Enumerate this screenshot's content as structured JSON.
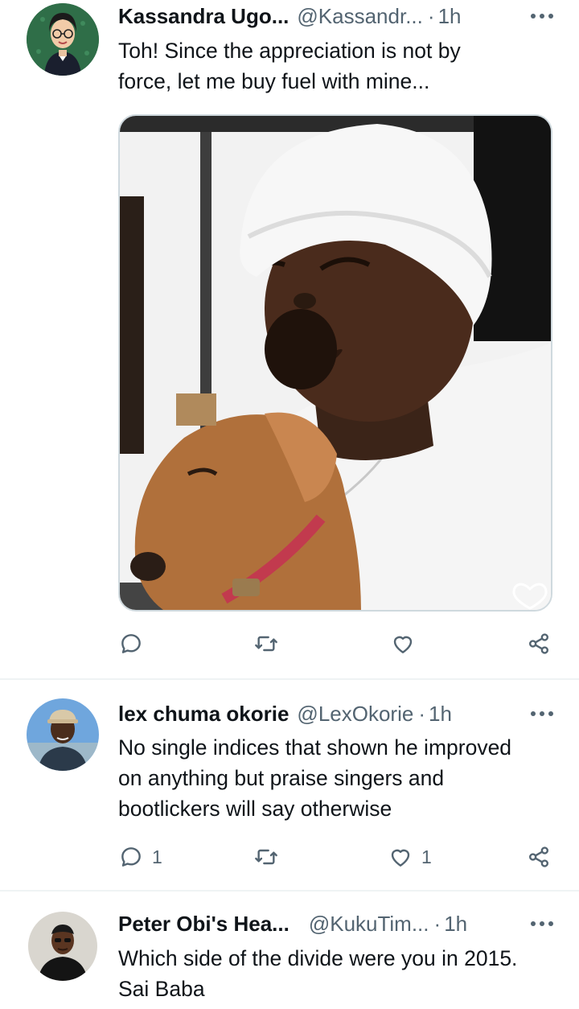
{
  "tweets": [
    {
      "name": "Kassandra Ugo...",
      "handle": "@Kassandr...",
      "dot": "·",
      "time": "1h",
      "text_lines": [
        "Toh! Since the appreciation is not by",
        "force, let me buy fuel with mine..."
      ],
      "replies": "",
      "retweets": "",
      "likes": ""
    },
    {
      "name": "lex chuma okorie",
      "handle": "@LexOkorie",
      "dot": "·",
      "time": "1h",
      "text_lines": [
        "No single indices that shown he improved",
        "on anything but praise singers and",
        "bootlickers will say otherwise"
      ],
      "replies": "1",
      "retweets": "",
      "likes": "1"
    },
    {
      "name": "Peter Obi's Hea...",
      "handle": "@KukuTim...",
      "dot": "·",
      "time": "1h",
      "text_lines": [
        "Which side of the divide were you in 2015.",
        "Sai Baba"
      ]
    }
  ],
  "colors": {
    "text_primary": "#0f1419",
    "text_secondary": "#536471",
    "divider": "#eff3f4",
    "media_border": "#cfd9de"
  },
  "icons": [
    "more-icon",
    "reply-icon",
    "retweet-icon",
    "like-icon",
    "share-icon"
  ]
}
